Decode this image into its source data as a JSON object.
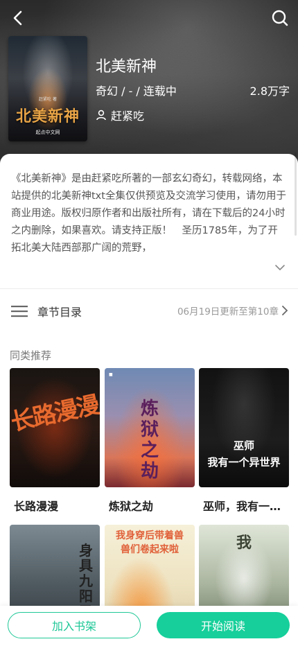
{
  "header": {
    "back_icon": "back-chevron-icon",
    "search_icon": "search-icon"
  },
  "book": {
    "title": "北美新神",
    "meta": "奇幻 / - / 连载中",
    "word_count": "2.8万字",
    "author": "赶紧吃",
    "cover": {
      "title_art": "北美新神",
      "author_mini": "赶紧吃 著",
      "publisher": "起点中文网"
    }
  },
  "description": "《北美新神》是由赶紧吃所著的一部玄幻奇幻，转载网络，本站提供的北美新神txt全集仅供预览及交流学习使用，请勿用于商业用途。版权归原作者和出版社所有，请在下载后的24小时之内删除，如果喜欢。请支持正版！　圣历1785年，为了开拓北美大陆西部那广阔的荒野，",
  "chapters": {
    "label": "章节目录",
    "update": "06月19日更新至第10章"
  },
  "recommend": {
    "title": "同类推荐",
    "items": [
      {
        "title": "长路漫漫",
        "cover_text": "长路漫漫",
        "color": "#e86a2e"
      },
      {
        "title": "炼狱之劫",
        "cover_text": "炼狱之劫",
        "color": "#5a1f5c"
      },
      {
        "title": "巫师，我有一个异世界",
        "cover_text": "巫师\n我有一个异世界",
        "color": "#ffffff"
      },
      {
        "title": "",
        "cover_text": "身具九阳圣",
        "color": "#222222"
      },
      {
        "title": "",
        "cover_text": "我身穿后带着兽兽们卷起来啦",
        "color": "#e0613a"
      },
      {
        "title": "",
        "cover_text": "我",
        "color": "#3c4436"
      }
    ]
  },
  "actions": {
    "add_shelf": "加入书架",
    "start_read": "开始阅读"
  },
  "colors": {
    "accent": "#16cf9a",
    "accent_border": "#1ec796"
  }
}
